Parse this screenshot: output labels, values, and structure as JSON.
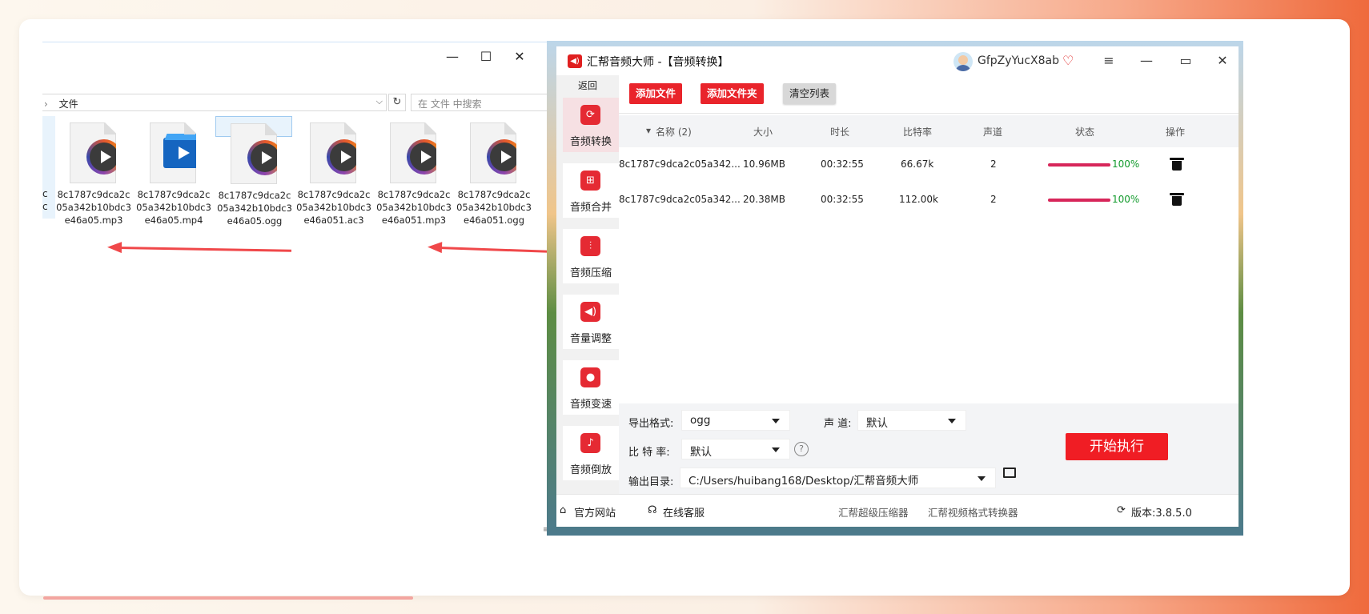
{
  "explorer": {
    "controls": {
      "minimize": "—",
      "maximize": "☐",
      "close": "✕"
    },
    "help": "?",
    "address": "文件",
    "search_placeholder": "在 文件 中搜索",
    "partial_label": "c",
    "files": [
      {
        "name": "8c1787c9dca2c05a342b10bdc3e46a05.mp3",
        "icon": "audio-play-icon",
        "selected": false
      },
      {
        "name": "8c1787c9dca2c05a342b10bdc3e46a05.mp4",
        "icon": "video-play-icon",
        "selected": false
      },
      {
        "name": "8c1787c9dca2c05a342b10bdc3e46a05.ogg",
        "icon": "audio-play-icon",
        "selected": true
      },
      {
        "name": "8c1787c9dca2c05a342b10bdc3e46a051.ac3",
        "icon": "audio-play-icon",
        "selected": false
      },
      {
        "name": "8c1787c9dca2c05a342b10bdc3e46a051.mp3",
        "icon": "audio-play-icon",
        "selected": false
      },
      {
        "name": "8c1787c9dca2c05a342b10bdc3e46a051.ogg",
        "icon": "audio-play-icon",
        "selected": false
      }
    ]
  },
  "app": {
    "title": "汇帮音频大师 -【音频转换】",
    "username": "GfpZyYucX8ab",
    "window": {
      "menu": "≡",
      "minimize": "—",
      "maximize": "▭",
      "close": "✕"
    },
    "sidebar": {
      "back": "返回",
      "items": [
        {
          "label": "音频转换",
          "icon": "audio-convert-icon",
          "active": true
        },
        {
          "label": "音频合并",
          "icon": "audio-merge-icon",
          "active": false
        },
        {
          "label": "音频压缩",
          "icon": "audio-compress-icon",
          "active": false
        },
        {
          "label": "音量调整",
          "icon": "volume-icon",
          "active": false
        },
        {
          "label": "音频变速",
          "icon": "microphone-icon",
          "active": false
        },
        {
          "label": "音频倒放",
          "icon": "music-note-icon",
          "active": false
        }
      ]
    },
    "toolbar": {
      "add_file": "添加文件",
      "add_folder": "添加文件夹",
      "clear_list": "清空列表"
    },
    "table": {
      "headers": {
        "name": "名称 (2)",
        "size": "大小",
        "duration": "时长",
        "bitrate": "比特率",
        "channel": "声道",
        "status": "状态",
        "action": "操作"
      },
      "rows": [
        {
          "name": "8c1787c9dca2c05a342...",
          "size": "10.96MB",
          "duration": "00:32:55",
          "bitrate": "66.67k",
          "channel": "2",
          "progress": "100%"
        },
        {
          "name": "8c1787c9dca2c05a342...",
          "size": "20.38MB",
          "duration": "00:32:55",
          "bitrate": "112.00k",
          "channel": "2",
          "progress": "100%"
        }
      ]
    },
    "settings": {
      "format_label": "导出格式:",
      "format_value": "ogg",
      "channel_label": "声 道:",
      "channel_value": "默认",
      "bitrate_label": "比 特 率:",
      "bitrate_value": "默认",
      "output_label": "输出目录:",
      "output_value": "C:/Users/huibang168/Desktop/汇帮音频大师",
      "start": "开始执行"
    },
    "footer": {
      "website": "官方网站",
      "service": "在线客服",
      "link1": "汇帮超级压缩器",
      "link2": "汇帮视频格式转换器",
      "version": "版本:3.8.5.0"
    },
    "colors": {
      "accent": "#e9242b",
      "progress": "#d7265a",
      "percent": "#119a2b",
      "annotation_arrow": "#f0484a"
    }
  }
}
